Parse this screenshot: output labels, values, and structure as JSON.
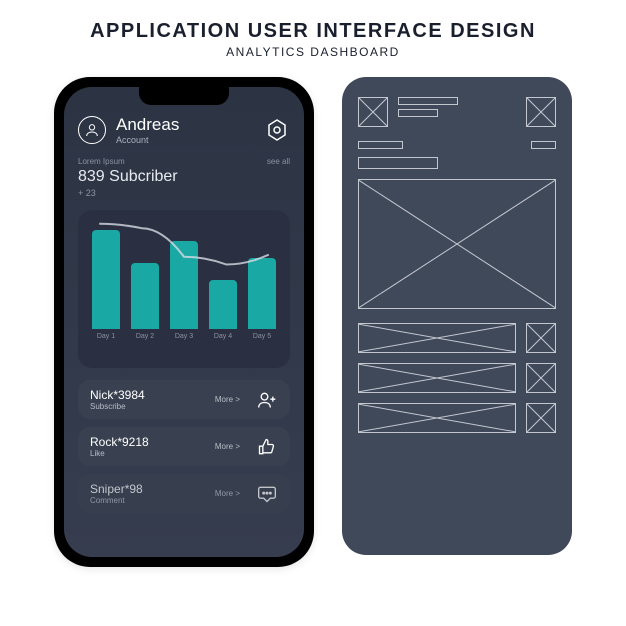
{
  "title": "APPLICATION USER INTERFACE DESIGN",
  "subtitle": "ANALYTICS DASHBOARD",
  "header": {
    "user_name": "Andreas",
    "account_label": "Account"
  },
  "stats": {
    "lorem": "Lorem Ipsum",
    "see_all": "see all",
    "subscriber_text": "839 Subcriber",
    "delta": "+ 23"
  },
  "chart_data": {
    "type": "bar",
    "categories": [
      "Day 1",
      "Day 2",
      "Day 3",
      "Day 4",
      "Day 5"
    ],
    "values": [
      90,
      60,
      80,
      45,
      65
    ],
    "line_values": [
      92,
      88,
      62,
      55,
      64
    ],
    "ylim": [
      0,
      100
    ],
    "bar_color": "#19a8a3",
    "line_color": "#d8dbe2"
  },
  "activities": [
    {
      "name": "Nick*3984",
      "action": "Subscribe",
      "more": "More >",
      "icon": "user-plus-icon"
    },
    {
      "name": "Rock*9218",
      "action": "Like",
      "more": "More >",
      "icon": "thumbs-up-icon"
    },
    {
      "name": "Sniper*98",
      "action": "Comment",
      "more": "More >",
      "icon": "comment-icon"
    }
  ]
}
